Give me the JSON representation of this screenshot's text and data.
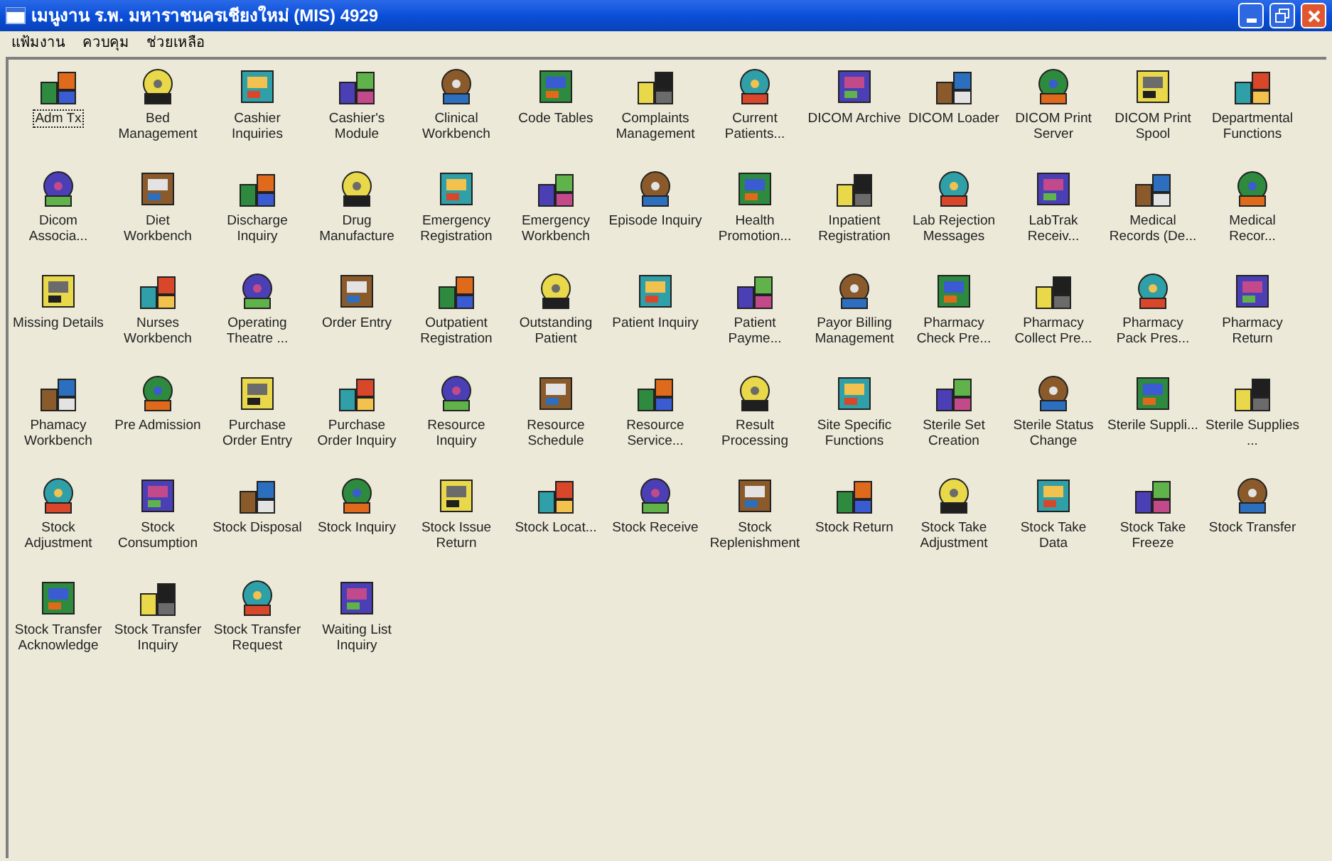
{
  "window": {
    "title": "เมนูงาน ร.พ. มหาราชนครเชียงใหม่ (MIS) 4929"
  },
  "menu": [
    "แฟ้มงาน",
    "ควบคุม",
    "ช่วยเหลือ"
  ],
  "items": [
    {
      "label": "Adm Tx",
      "selected": true
    },
    {
      "label": "Bed Management",
      "selected": false
    },
    {
      "label": "Cashier Inquiries",
      "selected": false
    },
    {
      "label": "Cashier's Module",
      "selected": false
    },
    {
      "label": "Clinical Workbench",
      "selected": false
    },
    {
      "label": "Code Tables",
      "selected": false
    },
    {
      "label": "Complaints Management",
      "selected": false
    },
    {
      "label": "Current Patients...",
      "selected": false
    },
    {
      "label": "DICOM Archive",
      "selected": false
    },
    {
      "label": "DICOM Loader",
      "selected": false
    },
    {
      "label": "DICOM Print Server",
      "selected": false
    },
    {
      "label": "DICOM Print Spool",
      "selected": false
    },
    {
      "label": "Departmental Functions",
      "selected": false
    },
    {
      "label": "Dicom Associa...",
      "selected": false
    },
    {
      "label": "Diet Workbench",
      "selected": false
    },
    {
      "label": "Discharge Inquiry",
      "selected": false
    },
    {
      "label": "Drug Manufacture",
      "selected": false
    },
    {
      "label": "Emergency Registration",
      "selected": false
    },
    {
      "label": "Emergency Workbench",
      "selected": false
    },
    {
      "label": "Episode Inquiry",
      "selected": false
    },
    {
      "label": "Health Promotion...",
      "selected": false
    },
    {
      "label": "Inpatient Registration",
      "selected": false
    },
    {
      "label": "Lab Rejection Messages",
      "selected": false
    },
    {
      "label": "LabTrak Receiv...",
      "selected": false
    },
    {
      "label": "Medical Records (De...",
      "selected": false
    },
    {
      "label": "Medical Recor...",
      "selected": false
    },
    {
      "label": "Missing Details",
      "selected": false
    },
    {
      "label": "Nurses Workbench",
      "selected": false
    },
    {
      "label": "Operating Theatre ...",
      "selected": false
    },
    {
      "label": "Order Entry",
      "selected": false
    },
    {
      "label": "Outpatient Registration",
      "selected": false
    },
    {
      "label": "Outstanding Patient",
      "selected": false
    },
    {
      "label": "Patient Inquiry",
      "selected": false
    },
    {
      "label": "Patient Payme...",
      "selected": false
    },
    {
      "label": "Payor Billing Management",
      "selected": false
    },
    {
      "label": "Pharmacy Check Pre...",
      "selected": false
    },
    {
      "label": "Pharmacy Collect Pre...",
      "selected": false
    },
    {
      "label": "Pharmacy Pack Pres...",
      "selected": false
    },
    {
      "label": "Pharmacy Return",
      "selected": false
    },
    {
      "label": "Phamacy Workbench",
      "selected": false
    },
    {
      "label": "Pre Admission",
      "selected": false
    },
    {
      "label": "Purchase Order Entry",
      "selected": false
    },
    {
      "label": "Purchase Order Inquiry",
      "selected": false
    },
    {
      "label": "Resource Inquiry",
      "selected": false
    },
    {
      "label": "Resource Schedule",
      "selected": false
    },
    {
      "label": "Resource Service...",
      "selected": false
    },
    {
      "label": "Result Processing",
      "selected": false
    },
    {
      "label": "Site Specific Functions",
      "selected": false
    },
    {
      "label": "Sterile Set Creation",
      "selected": false
    },
    {
      "label": "Sterile Status Change",
      "selected": false
    },
    {
      "label": "Sterile Suppli...",
      "selected": false
    },
    {
      "label": "Sterile Supplies ...",
      "selected": false
    },
    {
      "label": "Stock Adjustment",
      "selected": false
    },
    {
      "label": "Stock Consumption",
      "selected": false
    },
    {
      "label": "Stock Disposal",
      "selected": false
    },
    {
      "label": "Stock Inquiry",
      "selected": false
    },
    {
      "label": "Stock Issue Return",
      "selected": false
    },
    {
      "label": "Stock Locat...",
      "selected": false
    },
    {
      "label": "Stock Receive",
      "selected": false
    },
    {
      "label": "Stock Replenishment",
      "selected": false
    },
    {
      "label": "Stock Return",
      "selected": false
    },
    {
      "label": "Stock Take Adjustment",
      "selected": false
    },
    {
      "label": "Stock Take Data",
      "selected": false
    },
    {
      "label": "Stock Take Freeze",
      "selected": false
    },
    {
      "label": "Stock Transfer",
      "selected": false
    },
    {
      "label": "Stock Transfer Acknowledge",
      "selected": false
    },
    {
      "label": "Stock Transfer Inquiry",
      "selected": false
    },
    {
      "label": "Stock Transfer Request",
      "selected": false
    },
    {
      "label": "Waiting List Inquiry",
      "selected": false
    }
  ]
}
